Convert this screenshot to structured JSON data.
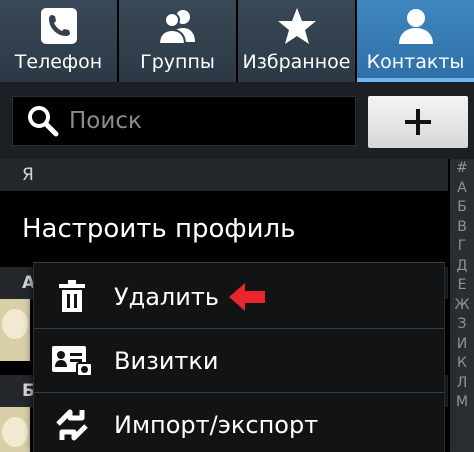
{
  "tabs": [
    {
      "label": "Телефон",
      "icon": "phone-icon"
    },
    {
      "label": "Группы",
      "icon": "group-icon"
    },
    {
      "label": "Избранное",
      "icon": "star-icon"
    },
    {
      "label": "Контакты",
      "icon": "contact-icon",
      "active": true
    }
  ],
  "search": {
    "placeholder": "Поиск",
    "value": ""
  },
  "add_button": {
    "label": "+"
  },
  "list": {
    "section_me": "Я",
    "profile_label": "Настроить профиль",
    "section_a": "А",
    "section_b": "Б"
  },
  "index_letters": [
    "#",
    "А",
    "Б",
    "В",
    "Г",
    "Д",
    "Е",
    "Ж",
    "З",
    "И",
    "К",
    "Л",
    "М"
  ],
  "menu": [
    {
      "label": "Удалить",
      "icon": "trash-icon"
    },
    {
      "label": "Визитки",
      "icon": "business-card-icon"
    },
    {
      "label": "Импорт/экспорт",
      "icon": "import-export-icon"
    }
  ],
  "colors": {
    "active_tab": "#3a7fb8",
    "inactive_tab": "#34414e",
    "annotation_arrow": "#e8262b"
  }
}
